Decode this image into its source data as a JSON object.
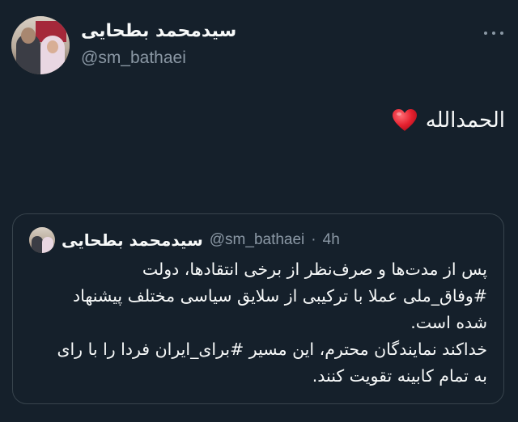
{
  "tweet": {
    "author": {
      "display_name": "سیدمحمد بطحایی",
      "handle": "@sm_bathaei"
    },
    "more_icon": "more-horizontal-icon",
    "text": "الحمدالله",
    "emoji": "red-heart-icon"
  },
  "quoted_tweet": {
    "author": {
      "display_name": "سیدمحمد بطحایی",
      "handle": "@sm_bathaei"
    },
    "separator": "·",
    "time": "4h",
    "lines": [
      "پس از مدت‌ها و صرف‌نظر از برخی انتقادها، دولت",
      "#وفاق_ملی عملا با ترکیبی از سلایق سیاسی مختلف پیشنهاد",
      "شده است.",
      "خداکند نمایندگان محترم، این مسیر #برای_ایران فردا را با رای",
      "به تمام کابینه تقویت کنند."
    ]
  },
  "colors": {
    "background": "#15202b",
    "text": "#f7f9f9",
    "secondary_text": "#8b98a5",
    "border": "#38444d",
    "heart": "#f91880"
  }
}
